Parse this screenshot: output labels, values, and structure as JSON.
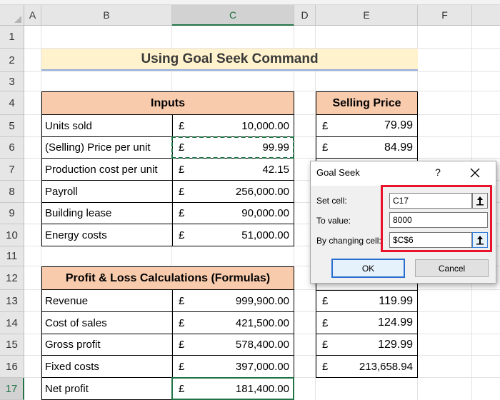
{
  "columns": [
    "A",
    "B",
    "C",
    "D",
    "E",
    "F"
  ],
  "rows": [
    "1",
    "2",
    "3",
    "4",
    "5",
    "6",
    "7",
    "8",
    "9",
    "10",
    "11",
    "12",
    "13",
    "14",
    "15",
    "16",
    "17"
  ],
  "title": "Using Goal Seek Command",
  "inputs": {
    "header": "Inputs",
    "items": [
      {
        "label": "Units sold",
        "currency": "",
        "value": "10,000.00"
      },
      {
        "label": "(Selling) Price per unit",
        "currency": "£",
        "value": "99.99"
      },
      {
        "label": "Production cost per unit",
        "currency": "£",
        "value": "42.15"
      },
      {
        "label": "Payroll",
        "currency": "£",
        "value": "256,000.00"
      },
      {
        "label": "Building lease",
        "currency": "£",
        "value": "90,000.00"
      },
      {
        "label": "Energy costs",
        "currency": "£",
        "value": "51,000.00"
      }
    ]
  },
  "pl": {
    "header": "Profit & Loss Calculations (Formulas)",
    "items": [
      {
        "label": "Revenue",
        "currency": "£",
        "value": "999,900.00"
      },
      {
        "label": "Cost of sales",
        "currency": "£",
        "value": "421,500.00"
      },
      {
        "label": "Gross profit",
        "currency": "£",
        "value": "578,400.00"
      },
      {
        "label": "Fixed costs",
        "currency": "£",
        "value": "397,000.00"
      },
      {
        "label": "Net profit",
        "currency": "£",
        "value": "181,400.00"
      }
    ]
  },
  "selling": {
    "header": "Selling Price",
    "items": [
      {
        "currency": "£",
        "value": "79.99"
      },
      {
        "currency": "£",
        "value": "84.99"
      },
      {
        "currency": "£",
        "value": "119.99"
      },
      {
        "currency": "£",
        "value": "124.99"
      },
      {
        "currency": "£",
        "value": "129.99"
      },
      {
        "currency": "£",
        "value": "213,658.94"
      }
    ]
  },
  "currency_symbol": "£",
  "dialog": {
    "title": "Goal Seek",
    "help": "?",
    "close": "✕",
    "set_cell_label": "Set cell:",
    "set_cell_value": "C17",
    "to_value_label": "To value:",
    "to_value_value": "8000",
    "changing_label": "By changing cell:",
    "changing_value": "$C$6",
    "ok": "OK",
    "cancel": "Cancel"
  },
  "icons": {
    "refedit": "range-select-icon",
    "close": "close-icon"
  },
  "colors": {
    "header_band": "#f8cbad",
    "title_band": "#fff2cc",
    "select_green": "#217346",
    "highlight_red": "#e8132b"
  }
}
